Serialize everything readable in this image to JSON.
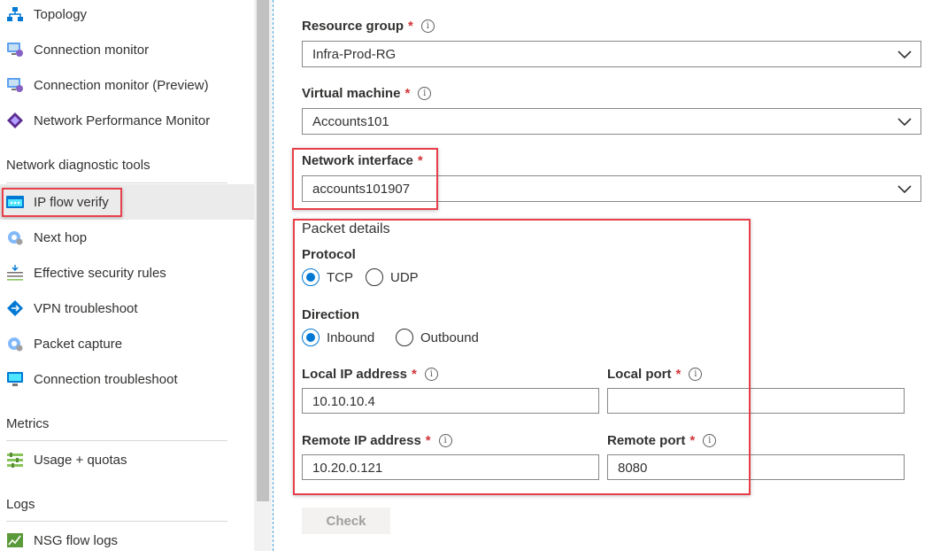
{
  "sidebar": {
    "items_top": [
      {
        "label": "Topology",
        "icon": "topology-icon"
      },
      {
        "label": "Connection monitor",
        "icon": "connection-monitor-icon"
      },
      {
        "label": "Connection monitor (Preview)",
        "icon": "connection-monitor-preview-icon"
      },
      {
        "label": "Network Performance Monitor",
        "icon": "network-performance-monitor-icon"
      }
    ],
    "diagnostic_heading": "Network diagnostic tools",
    "diagnostic_items": [
      {
        "label": "IP flow verify",
        "icon": "ip-flow-verify-icon",
        "active": true
      },
      {
        "label": "Next hop",
        "icon": "next-hop-icon"
      },
      {
        "label": "Effective security rules",
        "icon": "effective-security-rules-icon"
      },
      {
        "label": "VPN troubleshoot",
        "icon": "vpn-troubleshoot-icon"
      },
      {
        "label": "Packet capture",
        "icon": "packet-capture-icon"
      },
      {
        "label": "Connection troubleshoot",
        "icon": "connection-troubleshoot-icon"
      }
    ],
    "metrics_heading": "Metrics",
    "metrics_items": [
      {
        "label": "Usage + quotas",
        "icon": "usage-quotas-icon"
      }
    ],
    "logs_heading": "Logs",
    "logs_items": [
      {
        "label": "NSG flow logs",
        "icon": "nsg-flow-logs-icon"
      }
    ]
  },
  "form": {
    "resource_group": {
      "label": "Resource group",
      "required": "*",
      "value": "Infra-Prod-RG"
    },
    "virtual_machine": {
      "label": "Virtual machine",
      "required": "*",
      "value": "Accounts101"
    },
    "network_interface": {
      "label": "Network interface",
      "required": "*",
      "value": "accounts101907"
    },
    "packet_details_heading": "Packet details",
    "protocol": {
      "label": "Protocol",
      "options": [
        "TCP",
        "UDP"
      ],
      "selected": "TCP"
    },
    "direction": {
      "label": "Direction",
      "options": [
        "Inbound",
        "Outbound"
      ],
      "selected": "Inbound"
    },
    "local_ip": {
      "label": "Local IP address",
      "required": "*",
      "value": "10.10.10.4"
    },
    "local_port": {
      "label": "Local port",
      "required": "*",
      "value": ""
    },
    "remote_ip": {
      "label": "Remote IP address",
      "required": "*",
      "value": "10.20.0.121"
    },
    "remote_port": {
      "label": "Remote port",
      "required": "*",
      "value": "8080"
    },
    "info_glyph": "i",
    "check_button": "Check"
  },
  "colors": {
    "accent": "#0078d4",
    "required": "#d13438",
    "highlight": "#e8404a",
    "active_nav": "#ebebeb"
  }
}
